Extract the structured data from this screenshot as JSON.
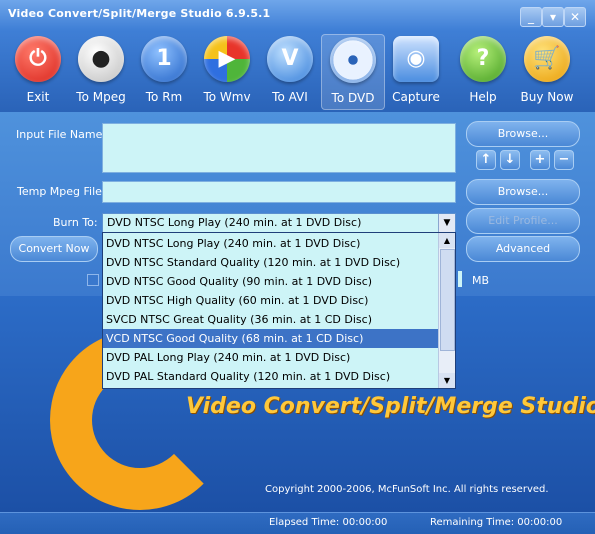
{
  "window": {
    "title": "Video Convert/Split/Merge Studio 6.9.5.1",
    "controls": [
      "_",
      "▾",
      "✕"
    ]
  },
  "toolbar": {
    "buttons": [
      {
        "label": "Exit",
        "icon": "power-icon",
        "color": "#e8342a"
      },
      {
        "label": "To Mpeg",
        "icon": "film-reel-icon",
        "color": "#f2f2f2"
      },
      {
        "label": "To Rm",
        "icon": "realmedia-icon",
        "color": "#2a72d6"
      },
      {
        "label": "To Wmv",
        "icon": "media-player-icon",
        "color": "#3c6ed6"
      },
      {
        "label": "To AVI",
        "icon": "avi-icon",
        "color": "#3f8ae0"
      },
      {
        "label": "To DVD",
        "icon": "dvd-disc-icon",
        "color": "#7aa8e6"
      },
      {
        "label": "Capture",
        "icon": "camcorder-icon",
        "color": "#4a8de0"
      },
      {
        "label": "Help",
        "icon": "help-icon",
        "color": "#55b028"
      },
      {
        "label": "Buy Now",
        "icon": "cart-icon",
        "color": "#f5b21a"
      }
    ]
  },
  "form": {
    "input_file_label": "Input File Name:",
    "input_file_value": "",
    "temp_mpeg_label": "Temp Mpeg File:",
    "temp_mpeg_value": "",
    "burn_to_label": "Burn To:",
    "burn_to_selected": "DVD NTSC Long Play (240 min. at 1 DVD Disc)",
    "browse_label_1": "Browse...",
    "browse_label_2": "Browse...",
    "edit_profile_label": "Edit Profile...",
    "convert_now_label": "Convert Now",
    "advanced_label": "Advanced",
    "mb_label": "MB"
  },
  "dropdown": {
    "options": [
      "DVD NTSC Long Play (240 min. at 1 DVD Disc)",
      "DVD NTSC Standard Quality (120 min. at 1 DVD Disc)",
      "DVD NTSC Good Quality (90 min. at 1 DVD Disc)",
      "DVD NTSC High Quality (60 min. at 1 DVD Disc)",
      "SVCD NTSC Great Quality (36 min. at 1 CD Disc)",
      "VCD NTSC Good Quality (68 min. at 1 CD Disc)",
      "DVD PAL Long Play (240 min. at 1 DVD Disc)",
      "DVD PAL Standard Quality (120 min. at 1 DVD Disc)"
    ],
    "highlighted_index": 5
  },
  "banner": {
    "title": "Video Convert/Split/Merge Studio",
    "copyright": "Copyright 2000-2006, McFunSoft Inc. All rights reserved."
  },
  "status": {
    "elapsed": "Elapsed Time: 00:00:00",
    "remaining": "Remaining Time: 00:00:00"
  }
}
